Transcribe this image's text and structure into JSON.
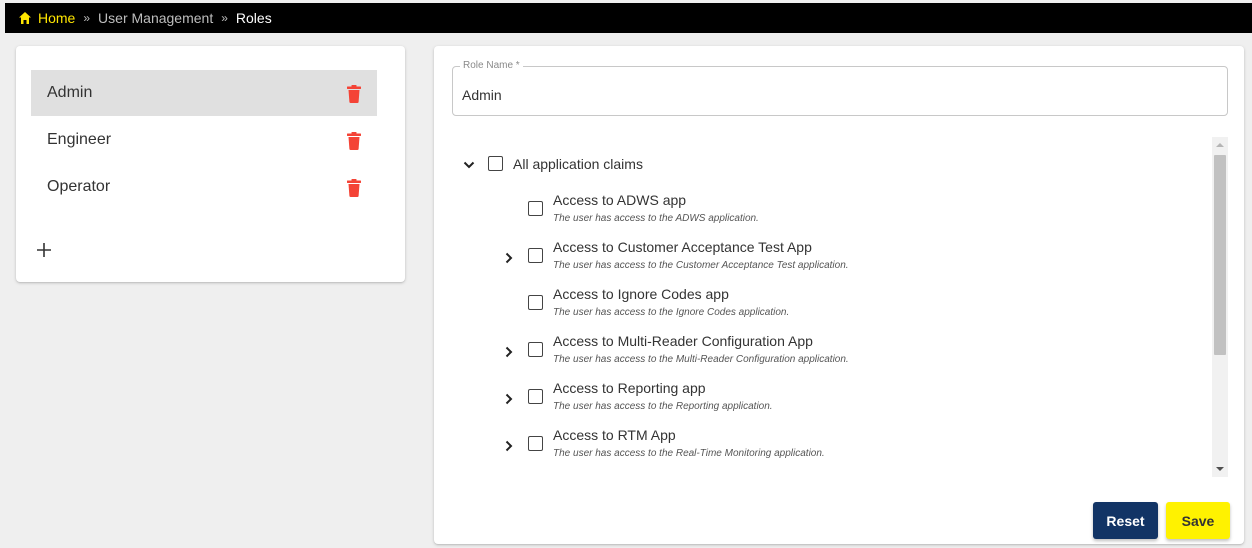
{
  "breadcrumb": {
    "home": "Home",
    "separator": "»",
    "section": "User Management",
    "current": "Roles"
  },
  "colors": {
    "brand_yellow": "#ffe600",
    "delete_red": "#f44336",
    "reset_navy": "#123465",
    "save_yellow": "#fff200"
  },
  "roles": [
    {
      "name": "Admin",
      "selected": true
    },
    {
      "name": "Engineer",
      "selected": false
    },
    {
      "name": "Operator",
      "selected": false
    }
  ],
  "icons": {
    "home": "home-icon",
    "delete": "trash-icon",
    "add": "plus-icon",
    "expand": "chevron-right-icon",
    "collapse": "chevron-down-icon"
  },
  "editor": {
    "role_name_label": "Role Name *",
    "role_name_value": "Admin",
    "root_claim": "All application claims",
    "claims": [
      {
        "title": "Access to ADWS app",
        "desc": "The user has access to the ADWS application.",
        "expandable": false
      },
      {
        "title": "Access to Customer Acceptance Test App",
        "desc": "The user has access to the Customer Acceptance Test application.",
        "expandable": true
      },
      {
        "title": "Access to Ignore Codes app",
        "desc": "The user has access to the Ignore Codes application.",
        "expandable": false
      },
      {
        "title": "Access to Multi-Reader Configuration App",
        "desc": "The user has access to the Multi-Reader Configuration application.",
        "expandable": true
      },
      {
        "title": "Access to Reporting app",
        "desc": "The user has access to the Reporting application.",
        "expandable": true
      },
      {
        "title": "Access to RTM App",
        "desc": "The user has access to the Real-Time Monitoring application.",
        "expandable": true
      }
    ],
    "reset_label": "Reset",
    "save_label": "Save"
  }
}
